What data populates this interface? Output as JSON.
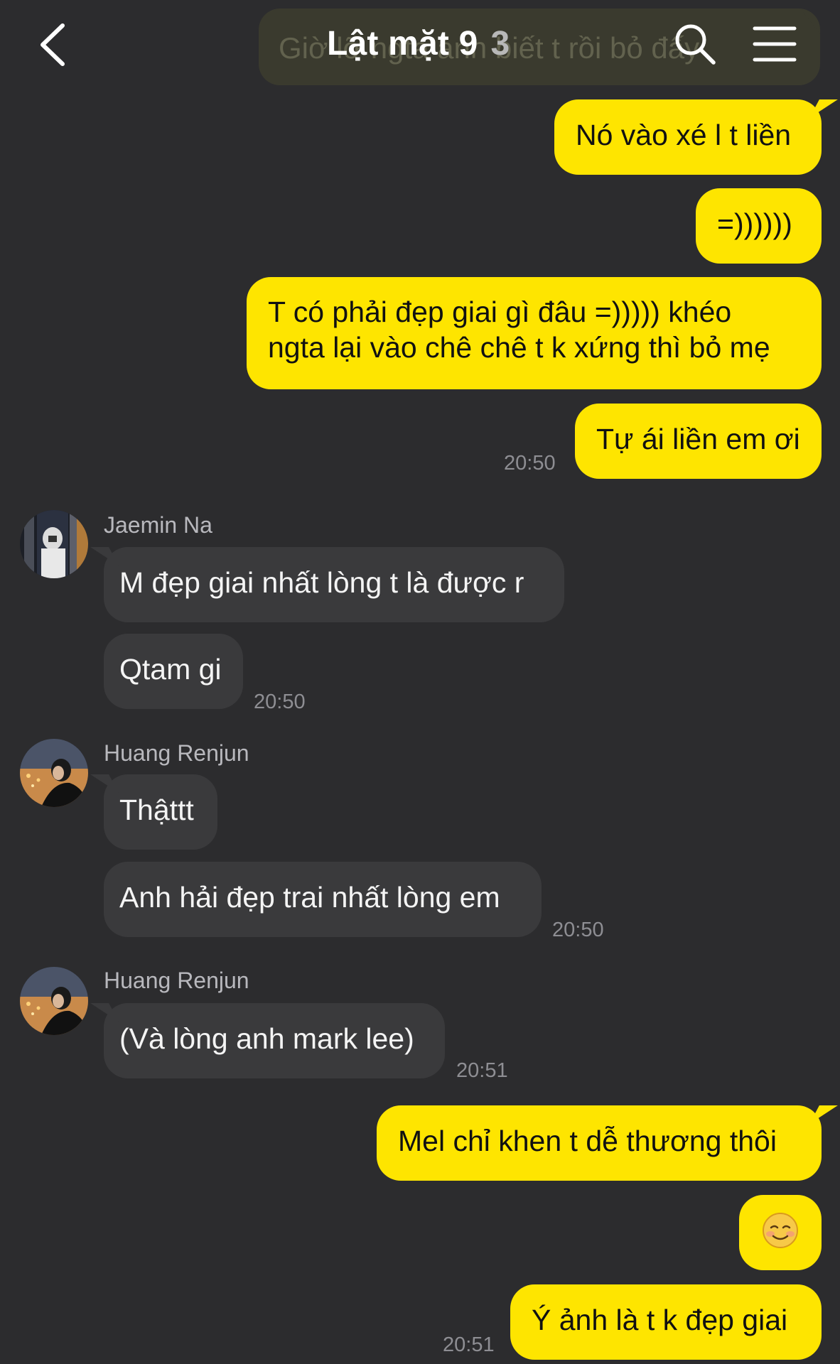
{
  "header": {
    "title": "Lật mặt 9",
    "member_count": "3",
    "pinned_preview": "Giờ lỡ ngta ảnh biết t rồi bỏ đấy"
  },
  "icons": {
    "back": "chevron-left-icon",
    "search": "search-icon",
    "menu": "hamburger-menu-icon",
    "emoji": "smiling-face-icon"
  },
  "colors": {
    "background": "#2c2c2e",
    "outgoing_bubble": "#fee500",
    "incoming_bubble": "#3a3a3c",
    "timestamp": "#8e8e93"
  },
  "messages": {
    "m1": {
      "text": "Nó vào xé l t liền"
    },
    "m2": {
      "text": "=))))))"
    },
    "m3": {
      "line1": "T có phải đẹp giai gì đâu =))))) khéo",
      "line2": "ngta lại vào chê chê t k xứng thì bỏ mẹ"
    },
    "m4": {
      "text": "Tự ái liền em ơi",
      "time": "20:50"
    },
    "g1": {
      "sender": "Jaemin Na",
      "msg1": "M đẹp giai nhất lòng t là được r",
      "msg2": "Qtam gi",
      "time": "20:50"
    },
    "g2": {
      "sender": "Huang Renjun",
      "msg1": "Thậttt",
      "msg2": "Anh hải đẹp trai nhất lòng em",
      "time": "20:50"
    },
    "g3": {
      "sender": "Huang Renjun",
      "msg1": "(Và lòng anh mark lee)",
      "time": "20:51"
    },
    "m5": {
      "text": "Mel chỉ khen t dễ thương thôi"
    },
    "m6": {
      "emoji": "☺️"
    },
    "m7": {
      "text": "Ý ảnh là t k đẹp giai",
      "time": "20:51"
    }
  }
}
